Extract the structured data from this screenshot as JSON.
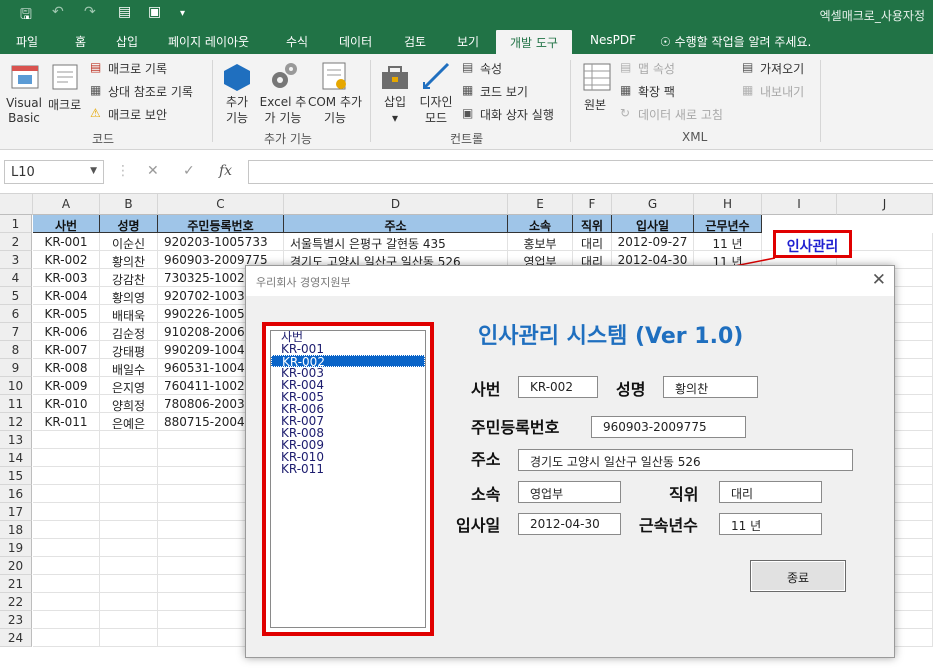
{
  "window": {
    "title": "엑셀매크로_사용자정"
  },
  "ribbon_tabs": [
    "파일",
    "홈",
    "삽입",
    "페이지 레이아웃",
    "수식",
    "데이터",
    "검토",
    "보기",
    "개발 도구",
    "NesPDF"
  ],
  "active_tab": "개발 도구",
  "tell_me": "수행할 작업을 알려 주세요.",
  "ribbon": {
    "code": {
      "visual_basic": "Visual Basic",
      "macro": "매크로",
      "record_macro": "매크로 기록",
      "relative_ref": "상대 참조로 기록",
      "macro_security": "매크로 보안",
      "label": "코드"
    },
    "addins": {
      "addins": "추가 기능",
      "excel_addins": "Excel 추가 기능",
      "com_addins": "COM 추가 기능",
      "label": "추가 기능"
    },
    "controls": {
      "insert": "삽입",
      "design_mode": "디자인 모드",
      "properties": "속성",
      "view_code": "코드 보기",
      "run_dialog": "대화 상자 실행",
      "label": "컨트롤"
    },
    "xml": {
      "source": "원본",
      "map_properties": "맵 속성",
      "expansion_packs": "확장 팩",
      "refresh_data": "데이터 새로 고침",
      "import": "가져오기",
      "export": "내보내기",
      "label": "XML"
    }
  },
  "formula_bar": {
    "name_box": "L10",
    "formula": ""
  },
  "sheet": {
    "columns": [
      "A",
      "B",
      "C",
      "D",
      "E",
      "F",
      "G",
      "H",
      "I",
      "J"
    ],
    "rows": [
      "1",
      "2",
      "3",
      "4",
      "5",
      "6",
      "7",
      "8",
      "9",
      "10",
      "11",
      "12",
      "13",
      "14",
      "15",
      "16",
      "17",
      "18",
      "19",
      "20",
      "21",
      "22",
      "23",
      "24"
    ],
    "headers": [
      "사번",
      "성명",
      "주민등록번호",
      "주소",
      "소속",
      "직위",
      "입사일",
      "근무년수"
    ],
    "data": [
      [
        "KR-001",
        "이순신",
        "920203-1005733",
        "서울특별시 은평구 갈현동 435",
        "홍보부",
        "대리",
        "2012-09-27",
        "11 년"
      ],
      [
        "KR-002",
        "황의찬",
        "960903-2009775",
        "경기도 고양시 일산구 일산동 526",
        "영업부",
        "대리",
        "2012-04-30",
        "11 년"
      ],
      [
        "KR-003",
        "강감찬",
        "730325-1002"
      ],
      [
        "KR-004",
        "황의영",
        "920702-1003"
      ],
      [
        "KR-005",
        "배태욱",
        "990226-1005"
      ],
      [
        "KR-006",
        "김순정",
        "910208-2006"
      ],
      [
        "KR-007",
        "강태평",
        "990209-1004"
      ],
      [
        "KR-008",
        "배일수",
        "960531-1004"
      ],
      [
        "KR-009",
        "은지영",
        "760411-1002"
      ],
      [
        "KR-010",
        "양희정",
        "780806-2003"
      ],
      [
        "KR-011",
        "은예은",
        "880715-2004"
      ]
    ],
    "hr_button": "인사관리"
  },
  "dialog": {
    "title": "우리회사 경영지원부",
    "heading": "인사관리 시스템 (Ver 1.0)",
    "list_items": [
      "사번",
      "KR-001",
      "KR-002",
      "KR-003",
      "KR-004",
      "KR-005",
      "KR-006",
      "KR-007",
      "KR-008",
      "KR-009",
      "KR-010",
      "KR-011"
    ],
    "selected_item": "KR-002",
    "fields": {
      "emp_id_label": "사번",
      "emp_id": "KR-002",
      "name_label": "성명",
      "name": "황의찬",
      "ssn_label": "주민등록번호",
      "ssn": "960903-2009775",
      "address_label": "주소",
      "address": "경기도 고양시 일산구 일산동 526",
      "dept_label": "소속",
      "dept": "영업부",
      "position_label": "직위",
      "position": "대리",
      "join_label": "입사일",
      "join_date": "2012-04-30",
      "tenure_label": "근속년수",
      "tenure": "11 년"
    },
    "close_button": "종료"
  },
  "colors": {
    "excel_green": "#217346",
    "header_fill": "#9fc5e8",
    "highlight_red": "#e00000",
    "title_blue": "#1f6fbf",
    "selection_blue": "#0a64c8"
  }
}
